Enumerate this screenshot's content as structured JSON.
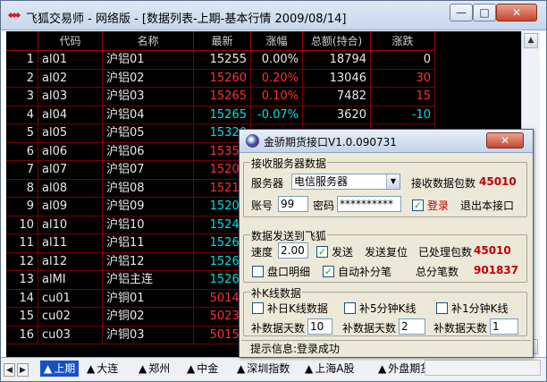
{
  "window": {
    "title": "飞狐交易师 - 网络版 - [数据列表-上期-基本行情 2009/08/14]",
    "min_label": "—",
    "max_label": "□",
    "close_label": "✕"
  },
  "table": {
    "columns": [
      "",
      "代码",
      "名称",
      "最新",
      "涨幅",
      "总额(持合)",
      "涨跌"
    ],
    "rows": [
      {
        "no": "1",
        "code": "al01",
        "name": "沪铝01",
        "last": "15255",
        "chg_pct": "0.00%",
        "total": "18794",
        "chg": "0",
        "color": "#e8e8e8"
      },
      {
        "no": "2",
        "code": "al02",
        "name": "沪铝02",
        "last": "15260",
        "chg_pct": "0.20%",
        "total": "13046",
        "chg": "30",
        "color": "#ff3030"
      },
      {
        "no": "3",
        "code": "al03",
        "name": "沪铝03",
        "last": "15265",
        "chg_pct": "0.10%",
        "total": "7482",
        "chg": "15",
        "color": "#ff3030"
      },
      {
        "no": "4",
        "code": "al04",
        "name": "沪铝04",
        "last": "15265",
        "chg_pct": "-0.07%",
        "total": "3620",
        "chg": "-10",
        "color": "#00e0e0"
      },
      {
        "no": "5",
        "code": "al05",
        "name": "沪铝05",
        "last": "15320",
        "chg_pct": "",
        "total": "",
        "chg": "",
        "color": "#00e0e0"
      },
      {
        "no": "6",
        "code": "al06",
        "name": "沪铝06",
        "last": "15350",
        "chg_pct": "",
        "total": "",
        "chg": "",
        "color": "#ff3030"
      },
      {
        "no": "7",
        "code": "al07",
        "name": "沪铝07",
        "last": "15200",
        "chg_pct": "",
        "total": "",
        "chg": "",
        "color": "#ff3030"
      },
      {
        "no": "8",
        "code": "al08",
        "name": "沪铝08",
        "last": "15210",
        "chg_pct": "",
        "total": "",
        "chg": "",
        "color": "#ff3030"
      },
      {
        "no": "9",
        "code": "al09",
        "name": "沪铝09",
        "last": "15200",
        "chg_pct": "",
        "total": "",
        "chg": "",
        "color": "#00e0e0"
      },
      {
        "no": "10",
        "code": "al10",
        "name": "沪铝10",
        "last": "15240",
        "chg_pct": "",
        "total": "",
        "chg": "",
        "color": "#00e0e0"
      },
      {
        "no": "11",
        "code": "al11",
        "name": "沪铝11",
        "last": "15260",
        "chg_pct": "",
        "total": "",
        "chg": "",
        "color": "#00e0e0"
      },
      {
        "no": "12",
        "code": "al12",
        "name": "沪铝12",
        "last": "15260",
        "chg_pct": "",
        "total": "",
        "chg": "",
        "color": "#00e0e0"
      },
      {
        "no": "13",
        "code": "alMI",
        "name": "沪铝主连",
        "last": "15260",
        "chg_pct": "",
        "total": "",
        "chg": "",
        "color": "#00e0e0"
      },
      {
        "no": "14",
        "code": "cu01",
        "name": "沪铜01",
        "last": "50140",
        "chg_pct": "",
        "total": "",
        "chg": "",
        "color": "#ff3030"
      },
      {
        "no": "15",
        "code": "cu02",
        "name": "沪铜02",
        "last": "50230",
        "chg_pct": "",
        "total": "",
        "chg": "",
        "color": "#ff3030"
      },
      {
        "no": "16",
        "code": "cu03",
        "name": "沪铜03",
        "last": "50150",
        "chg_pct": "",
        "total": "",
        "chg": "",
        "color": "#ff3030"
      }
    ]
  },
  "tabs": [
    {
      "label": "上期",
      "active": true
    },
    {
      "label": "大连",
      "active": false
    },
    {
      "label": "郑州",
      "active": false
    },
    {
      "label": "中金",
      "active": false
    },
    {
      "label": "深圳指数",
      "active": false
    },
    {
      "label": "上海A股",
      "active": false
    },
    {
      "label": "外盘期货",
      "active": false
    }
  ],
  "dialog": {
    "title": "金骄期货接口V1.0.090731",
    "close_label": "✕",
    "receive_group": {
      "label": "接收服务器数据",
      "server_label": "服务器",
      "server_value": "电信服务器",
      "packets_label": "接收数据包数",
      "packets_value": "45010",
      "account_label": "账号",
      "account_value": "99",
      "password_label": "密码",
      "password_value": "**********",
      "login_label": "登录",
      "exit_label": "退出本接口"
    },
    "send_group": {
      "label": "数据发送到飞狐",
      "speed_label": "速度",
      "speed_value": "2.00",
      "send_label": "发送",
      "reset_label": "发送复位",
      "processed_label": "已处理包数",
      "processed_value": "45010",
      "board_label": "盘口明细",
      "auto_fill_label": "自动补分笔",
      "total_ticks_label": "总分笔数",
      "total_ticks_value": "901837"
    },
    "fill_group": {
      "label": "补K线数据",
      "daily_label": "补日K线数据",
      "min5_label": "补5分钟K线",
      "min1_label": "补1分钟K线",
      "days_label": "补数据天数",
      "days_daily": "10",
      "days_min5": "2",
      "days_min1": "1"
    },
    "status_text": "提示信息:登录成功"
  }
}
